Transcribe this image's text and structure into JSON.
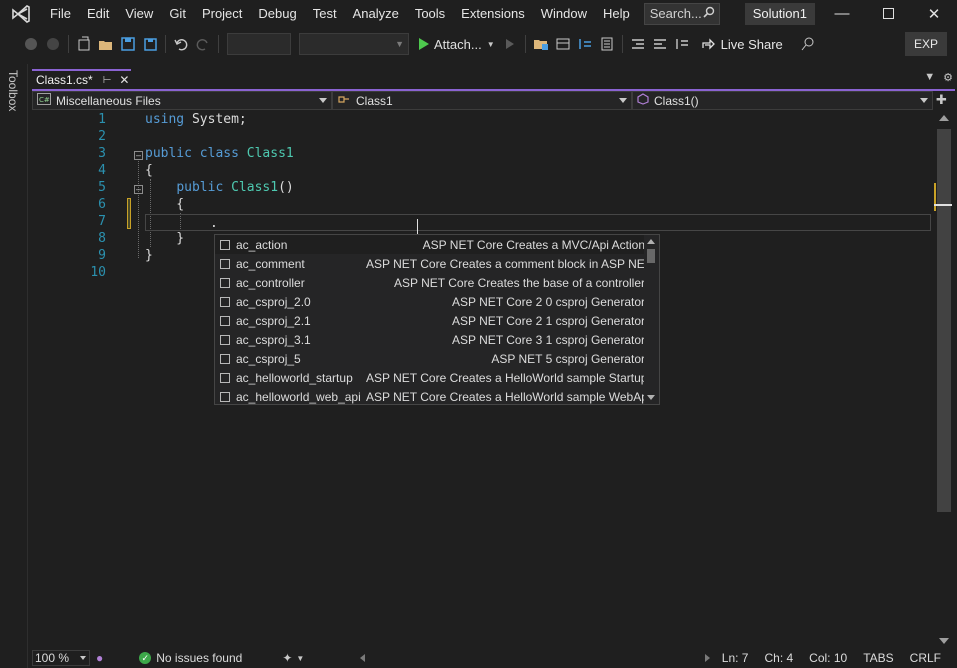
{
  "menubar": {
    "items": [
      "File",
      "Edit",
      "View",
      "Git",
      "Project",
      "Debug",
      "Test",
      "Analyze",
      "Tools",
      "Extensions",
      "Window",
      "Help"
    ],
    "search_label": "Search...",
    "solution_name": "Solution1"
  },
  "toolbar": {
    "attach_label": "Attach...",
    "live_share_label": "Live Share",
    "exp_label": "EXP"
  },
  "toolbox": {
    "label": "Toolbox"
  },
  "tabs": {
    "active_tab": "Class1.cs*"
  },
  "navbar": {
    "project": "Miscellaneous Files",
    "type": "Class1",
    "member": "Class1()"
  },
  "editor": {
    "line_numbers": [
      "1",
      "2",
      "3",
      "4",
      "5",
      "6",
      "7",
      "8",
      "9",
      "10"
    ],
    "current_line_text": "."
  },
  "completion": {
    "items": [
      {
        "name": "ac_action",
        "desc": "ASP NET Core Creates a MVC/Api Action"
      },
      {
        "name": "ac_comment",
        "desc": "ASP NET Core Creates a comment block in ASP NET"
      },
      {
        "name": "ac_controller",
        "desc": "ASP NET Core Creates the base of a controller"
      },
      {
        "name": "ac_csproj_2.0",
        "desc": "ASP NET Core 2 0 csproj Generator"
      },
      {
        "name": "ac_csproj_2.1",
        "desc": "ASP NET Core 2 1 csproj Generator"
      },
      {
        "name": "ac_csproj_3.1",
        "desc": "ASP NET Core 3 1 csproj Generator"
      },
      {
        "name": "ac_csproj_5",
        "desc": "ASP NET 5 csproj Generator"
      },
      {
        "name": "ac_helloworld_startup",
        "desc": "ASP NET Core Creates a HelloWorld sample Startup"
      },
      {
        "name": "ac_helloworld_web_api",
        "desc": "ASP NET Core Creates a HelloWorld sample WebApi"
      }
    ]
  },
  "statusbar": {
    "zoom": "100 %",
    "issues": "No issues found",
    "line": "Ln: 7",
    "ch": "Ch: 4",
    "col": "Col: 10",
    "indent": "TABS",
    "eol": "CRLF"
  },
  "colors": {
    "accent": "#8a63d2",
    "keyword": "#569cd6",
    "type": "#4ec9b0",
    "line_number": "#2b91af",
    "success": "#3da84a"
  }
}
